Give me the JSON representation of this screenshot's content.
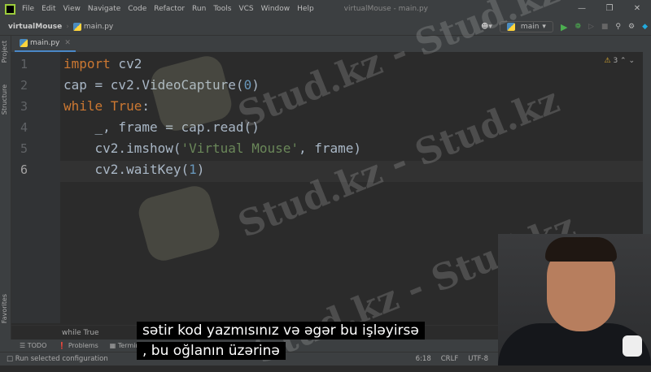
{
  "menu": [
    "File",
    "Edit",
    "View",
    "Navigate",
    "Code",
    "Refactor",
    "Run",
    "Tools",
    "VCS",
    "Window",
    "Help"
  ],
  "window_title": "virtualMouse - main.py",
  "breadcrumb": {
    "project": "virtualMouse",
    "file": "main.py"
  },
  "run_config": "main",
  "tab": "main.py",
  "side": {
    "project": "Project",
    "structure": "Structure",
    "favorites": "Favorites"
  },
  "warnings": "3",
  "line_numbers": [
    "1",
    "2",
    "3",
    "4",
    "5",
    "6"
  ],
  "code": {
    "l1": [
      "import",
      " cv2"
    ],
    "l2": [
      "cap = cv2.VideoCapture(",
      "0",
      ")"
    ],
    "l3": [
      "while",
      " ",
      "True",
      ":"
    ],
    "l4": [
      "    _, frame = cap.read()"
    ],
    "l5": [
      "    cv2.imshow(",
      "'Virtual Mouse'",
      ", frame)"
    ],
    "l6": [
      "    cv2.waitKey(",
      "1",
      ")"
    ]
  },
  "editor_crumb": "while True",
  "toolwindows": [
    "TODO",
    "Problems",
    "Terminal"
  ],
  "status": {
    "message": "Run selected configuration",
    "position": "6:18",
    "line_sep": "CRLF",
    "encoding": "UTF-8"
  },
  "subtitles": [
    "sətir kod yazmısınız və əgər bu işləyirsə",
    ", bu oğlanın üzərinə"
  ],
  "watermark": "Stud.kz - Stud.kz"
}
